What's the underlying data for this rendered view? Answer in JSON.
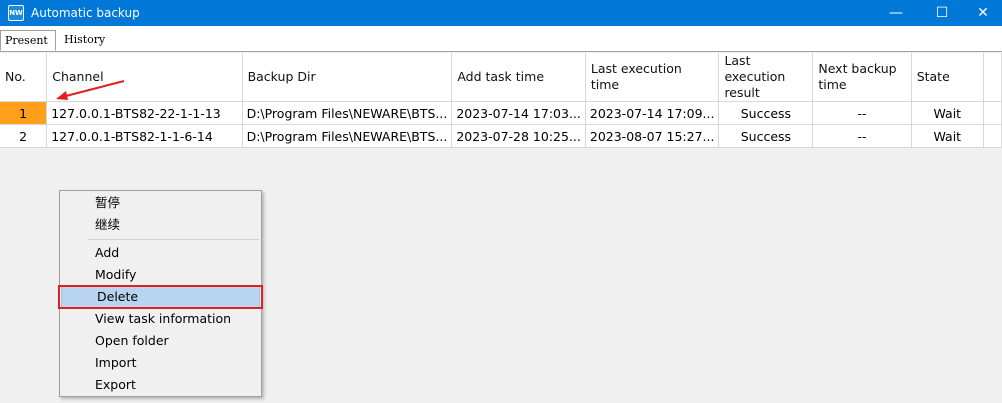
{
  "window": {
    "app_icon_text": "NW",
    "title": "Automatic backup",
    "minimize": "—",
    "maximize": "☐",
    "close": "✕"
  },
  "tabs": [
    {
      "label": "Present",
      "active": true
    },
    {
      "label": "History",
      "active": false
    }
  ],
  "table": {
    "columns": [
      "No.",
      "Channel",
      "Backup Dir",
      "Add task time",
      "Last execution time",
      "Last execution result",
      "Next backup time",
      "State"
    ],
    "rows": [
      {
        "no": "1",
        "channel": "127.0.0.1-BTS82-22-1-1-13",
        "backup_dir": "D:\\Program Files\\NEWARE\\BTS...",
        "add_task_time": "2023-07-14 17:03...",
        "last_execution_time": "2023-07-14 17:09...",
        "last_execution_result": "Success",
        "next_backup_time": "--",
        "state": "Wait",
        "selected": true
      },
      {
        "no": "2",
        "channel": "127.0.0.1-BTS82-1-1-6-14",
        "backup_dir": "D:\\Program Files\\NEWARE\\BTS...",
        "add_task_time": "2023-07-28 10:25...",
        "last_execution_time": "2023-08-07 15:27...",
        "last_execution_result": "Success",
        "next_backup_time": "--",
        "state": "Wait",
        "selected": false
      }
    ]
  },
  "context_menu": {
    "items": [
      "暂停",
      "继续",
      "Add",
      "Modify",
      "Delete",
      "View task information",
      "Open folder",
      "Import",
      "Export"
    ],
    "highlighted": "Delete"
  },
  "annotation_colors": {
    "arrow": "#e02020",
    "highlight_box": "#e02020",
    "selected_cell": "#ff9f1a",
    "titlebar": "#0078d7"
  }
}
